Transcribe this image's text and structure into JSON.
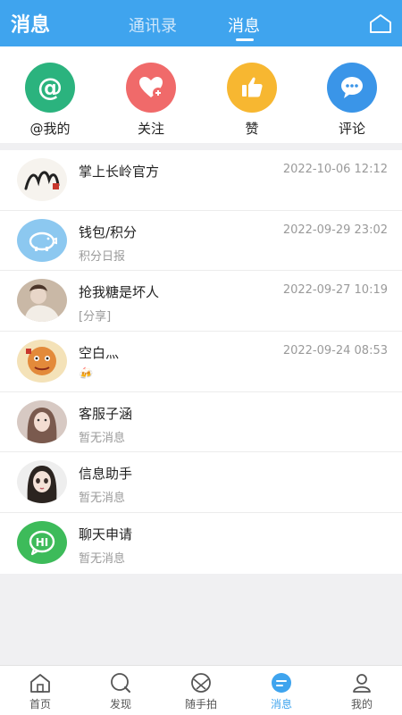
{
  "header": {
    "title": "消息",
    "tabs": [
      "通讯录",
      "消息"
    ],
    "active_tab": "消息",
    "home_icon": "home-outline-icon"
  },
  "actions": [
    {
      "label": "@我的",
      "icon": "at-icon",
      "color": "#2bb37e"
    },
    {
      "label": "关注",
      "icon": "heart-plus-icon",
      "color": "#f06a6a"
    },
    {
      "label": "赞",
      "icon": "thumbs-up-icon",
      "color": "#f7b731"
    },
    {
      "label": "评论",
      "icon": "comment-icon",
      "color": "#3a95e8"
    }
  ],
  "messages": [
    {
      "name": "掌上长岭官方",
      "sub": "",
      "time": "2022-10-06 12:12",
      "avatar": "changling-logo-icon"
    },
    {
      "name": "钱包/积分",
      "sub": "积分日报",
      "time": "2022-09-29 23:02",
      "avatar": "piggy-bank-icon"
    },
    {
      "name": "抢我糖是坏人",
      "sub": "[分享]",
      "time": "2022-09-27 10:19",
      "avatar": "user-avatar"
    },
    {
      "name": "空白灬",
      "sub": "🍻",
      "time": "2022-09-24 08:53",
      "avatar": "user-avatar"
    },
    {
      "name": "客服子涵",
      "sub": "暂无消息",
      "time": "",
      "avatar": "user-avatar"
    },
    {
      "name": "信息助手",
      "sub": "暂无消息",
      "time": "",
      "avatar": "user-avatar"
    },
    {
      "name": "聊天申请",
      "sub": "暂无消息",
      "time": "",
      "avatar": "hi-chat-icon"
    }
  ],
  "bottom_nav": [
    {
      "label": "首页",
      "icon": "home-icon"
    },
    {
      "label": "发现",
      "icon": "discover-icon"
    },
    {
      "label": "随手拍",
      "icon": "camera-icon"
    },
    {
      "label": "消息",
      "icon": "message-icon",
      "active": true
    },
    {
      "label": "我的",
      "icon": "profile-icon"
    }
  ],
  "colors": {
    "header_bg": "#3fa4ee",
    "active_nav": "#3fa4ee",
    "hi_chat": "#3dbb5a"
  }
}
